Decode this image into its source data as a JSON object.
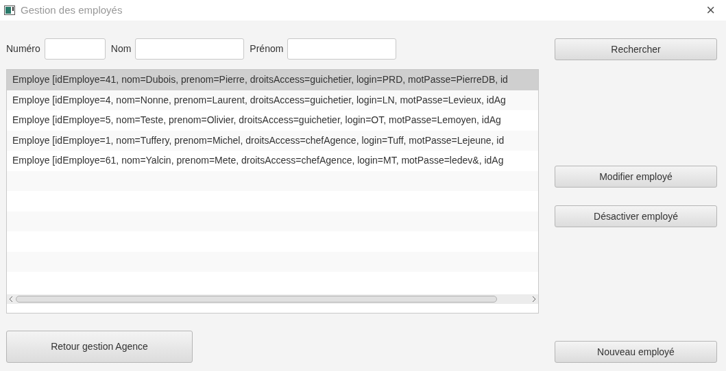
{
  "window": {
    "title": "Gestion des employés",
    "close": "×"
  },
  "search": {
    "fields": [
      {
        "label": "Numéro"
      },
      {
        "label": "Nom"
      },
      {
        "label": "Prénom"
      }
    ],
    "button": "Rechercher"
  },
  "list": {
    "rows": [
      {
        "text": "Employe [idEmploye=41, nom=Dubois, prenom=Pierre, droitsAccess=guichetier, login=PRD, motPasse=PierreDB, id",
        "selected": true
      },
      {
        "text": "Employe [idEmploye=4, nom=Nonne, prenom=Laurent, droitsAccess=guichetier, login=LN, motPasse=Levieux, idAg",
        "selected": false
      },
      {
        "text": "Employe [idEmploye=5, nom=Teste, prenom=Olivier, droitsAccess=guichetier, login=OT, motPasse=Lemoyen, idAg",
        "selected": false
      },
      {
        "text": "Employe [idEmploye=1, nom=Tuffery, prenom=Michel, droitsAccess=chefAgence, login=Tuff, motPasse=Lejeune, id",
        "selected": false
      },
      {
        "text": "Employe [idEmploye=61, nom=Yalcin, prenom=Mete, droitsAccess=chefAgence, login=MT, motPasse=ledev&, idAg",
        "selected": false
      }
    ]
  },
  "actions": {
    "modify": "Modifier employé",
    "deactivate": "Désactiver employé",
    "back": "Retour gestion Agence",
    "new": "Nouveau employé"
  }
}
